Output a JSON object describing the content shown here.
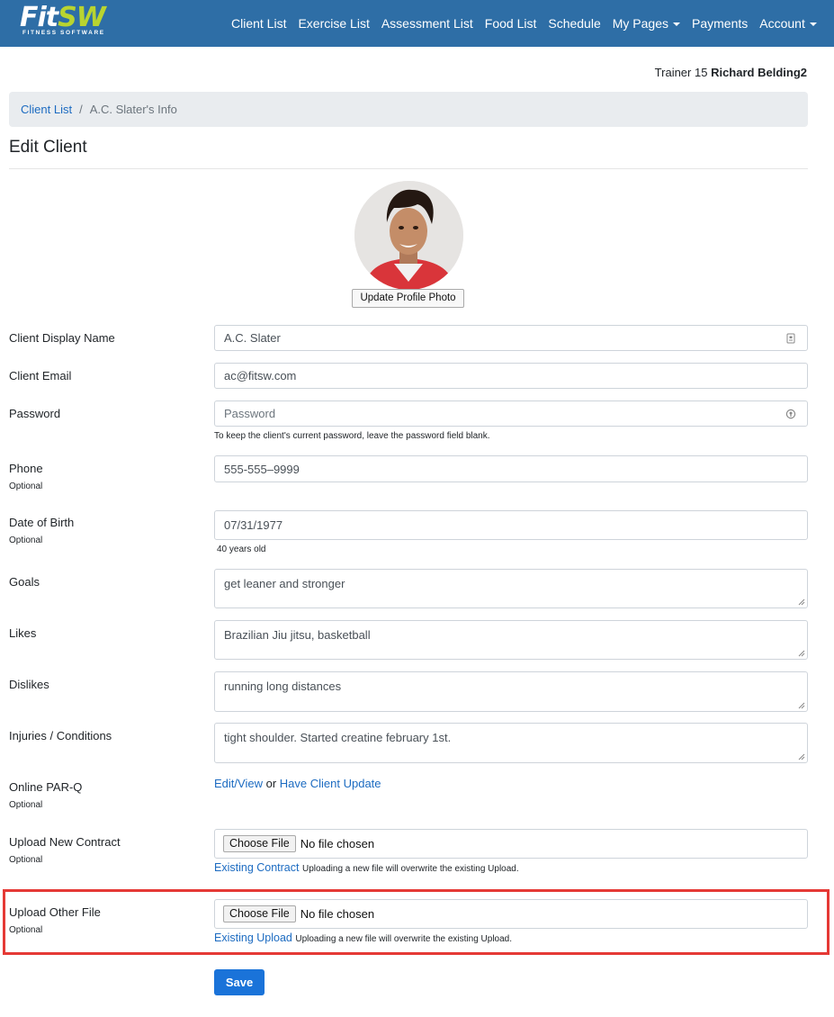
{
  "brand": {
    "name_part1": "Fit",
    "name_part2": "SW",
    "tagline": "FITNESS SOFTWARE"
  },
  "nav": {
    "items": [
      {
        "label": "Client List",
        "dropdown": false
      },
      {
        "label": "Exercise List",
        "dropdown": false
      },
      {
        "label": "Assessment List",
        "dropdown": false
      },
      {
        "label": "Food List",
        "dropdown": false
      },
      {
        "label": "Schedule",
        "dropdown": false
      },
      {
        "label": "My Pages",
        "dropdown": true
      },
      {
        "label": "Payments",
        "dropdown": false
      },
      {
        "label": "Account",
        "dropdown": true
      }
    ]
  },
  "trainer": {
    "prefix": "Trainer 15",
    "name": "Richard Belding2"
  },
  "breadcrumb": {
    "link": "Client List",
    "separator": "/",
    "current": "A.C. Slater's Info"
  },
  "page_title": "Edit Client",
  "profile": {
    "update_photo_label": "Update Profile Photo"
  },
  "form": {
    "display_name": {
      "label": "Client Display Name",
      "value": "A.C. Slater"
    },
    "email": {
      "label": "Client Email",
      "value": "ac@fitsw.com"
    },
    "password": {
      "label": "Password",
      "placeholder": "Password",
      "help": "To keep the client's current password, leave the password field blank."
    },
    "phone": {
      "label": "Phone",
      "sub": "Optional",
      "value": "555-555–9999"
    },
    "dob": {
      "label": "Date of Birth",
      "sub": "Optional",
      "value": "07/31/1977",
      "help": "40 years old"
    },
    "goals": {
      "label": "Goals",
      "value": "get leaner and stronger"
    },
    "likes": {
      "label": "Likes",
      "value": "Brazilian Jiu jitsu, basketball"
    },
    "dislikes": {
      "label": "Dislikes",
      "value": "running long distances"
    },
    "injuries": {
      "label": "Injuries / Conditions",
      "value": "tight shoulder. Started creatine february 1st."
    },
    "parq": {
      "label": "Online PAR-Q",
      "sub": "Optional",
      "edit_link": "Edit/View",
      "or_text": "or",
      "update_link": "Have Client Update"
    },
    "contract": {
      "label": "Upload New Contract",
      "sub": "Optional",
      "button": "Choose File",
      "file_status": "No file chosen",
      "existing_link": "Existing Contract",
      "note": "Uploading a new file will overwrite the existing Upload."
    },
    "other_file": {
      "label": "Upload Other File",
      "sub": "Optional",
      "button": "Choose File",
      "file_status": "No file chosen",
      "existing_link": "Existing Upload",
      "note": "Uploading a new file will overwrite the existing Upload."
    },
    "save_label": "Save"
  },
  "colors": {
    "navbar": "#2e6ea6",
    "link": "#1c6bc1",
    "primary_button": "#1a73d9",
    "highlight": "#e53935",
    "brand_accent": "#b9d430"
  }
}
